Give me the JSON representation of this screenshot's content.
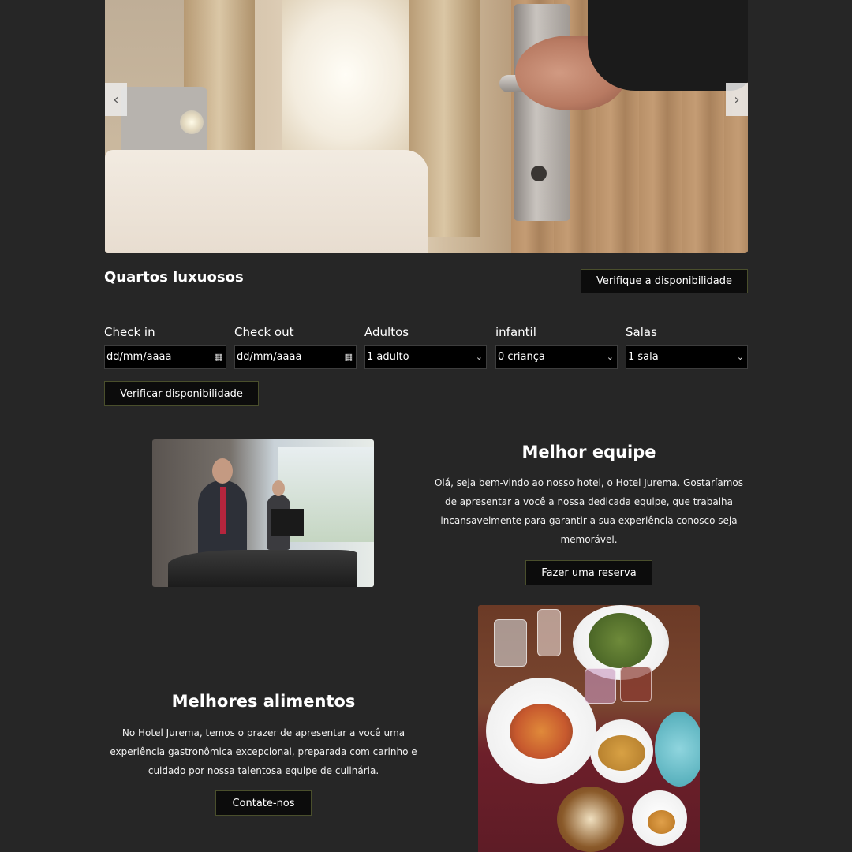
{
  "carousel": {
    "prev_icon": "chevron-left-icon",
    "next_icon": "chevron-right-icon",
    "prev_glyph": "‹",
    "next_glyph": "›"
  },
  "booking": {
    "title": "Quartos luxuosos",
    "check_availability_top": "Verifique a disponibilidade",
    "fields": [
      {
        "label": "Check in",
        "value": "dd/mm/aaaa",
        "icon": "calendar-icon"
      },
      {
        "label": "Check out",
        "value": "dd/mm/aaaa",
        "icon": "calendar-icon"
      },
      {
        "label": "Adultos",
        "value": "1 adulto",
        "icon": "chevron-down-icon"
      },
      {
        "label": "infantil",
        "value": "0 criança",
        "icon": "chevron-down-icon"
      },
      {
        "label": "Salas",
        "value": "1 sala",
        "icon": "chevron-down-icon"
      }
    ],
    "verify_button": "Verificar disponibilidade"
  },
  "team": {
    "title": "Melhor equipe",
    "text": "Olá, seja bem-vindo ao nosso hotel, o Hotel Jurema. Gostaríamos de apresentar a você a nossa dedicada equipe, que trabalha incansavelmente para garantir a sua experiência conosco seja memorável.",
    "button": "Fazer uma reserva"
  },
  "food": {
    "title": "Melhores alimentos",
    "text": "No Hotel Jurema, temos o prazer de apresentar a você uma experiência gastronômica excepcional, preparada com carinho e cuidado por nossa talentosa equipe de culinária.",
    "button": "Contate-nos"
  },
  "colors": {
    "background": "#262626",
    "button_bg": "#0c0c0c",
    "button_border": "#4a4f2c",
    "field_bg": "#000000"
  }
}
